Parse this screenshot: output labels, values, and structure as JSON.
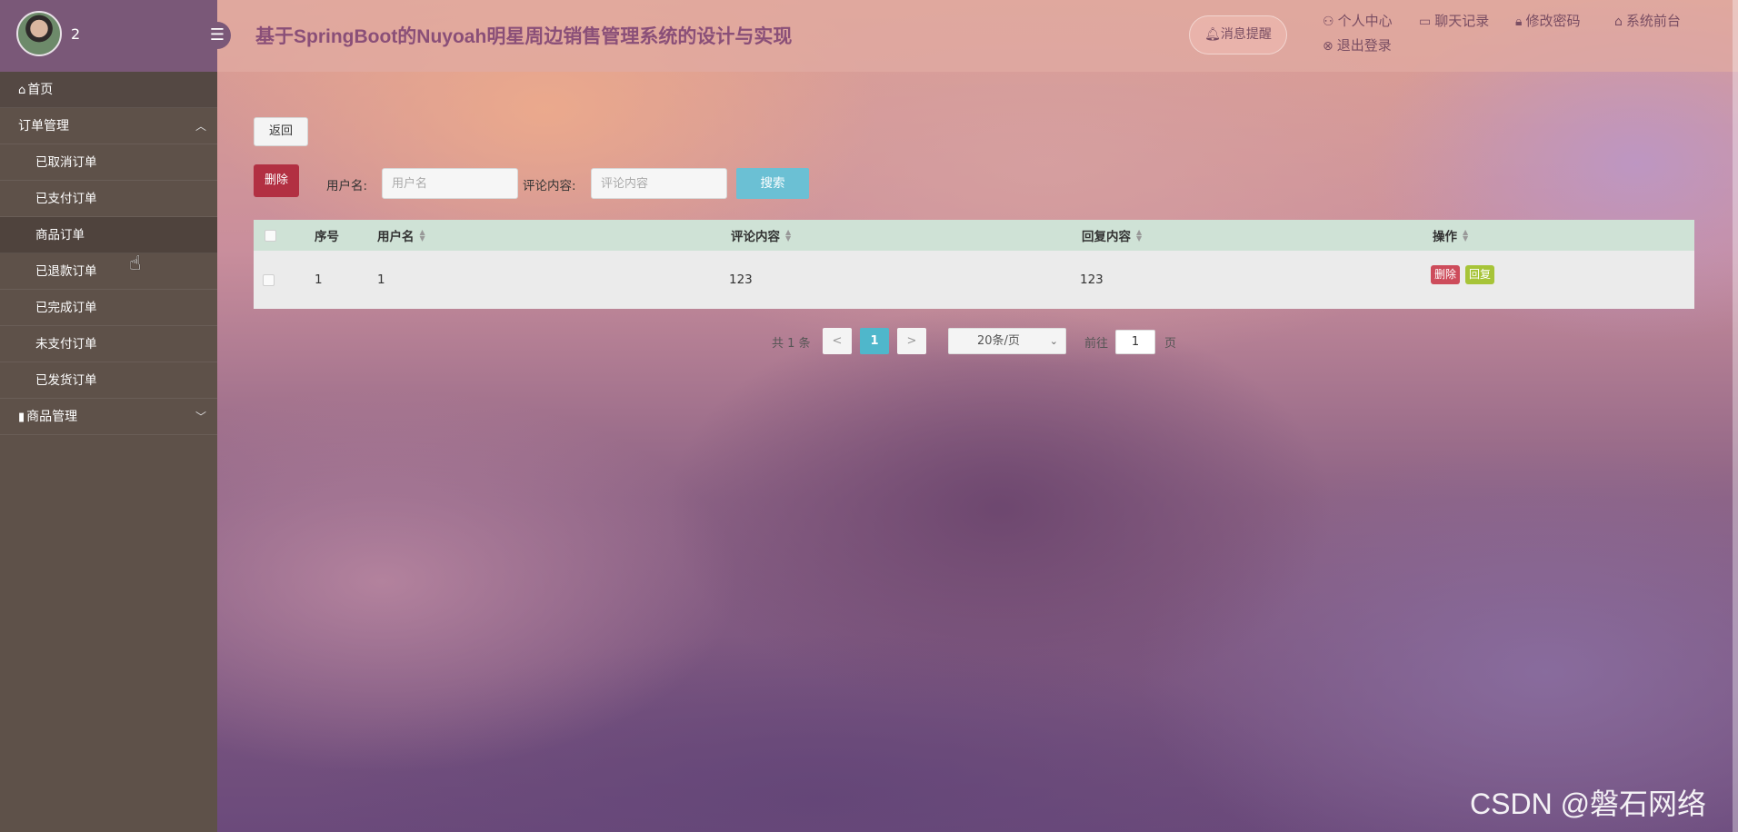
{
  "app": {
    "title": "基于SpringBoot的Nuyoah明星周边销售管理系统的设计与实现"
  },
  "user": {
    "name": "2"
  },
  "header": {
    "notify_label": "消息提醒",
    "links": {
      "profile": "个人中心",
      "chat": "聊天记录",
      "password": "修改密码",
      "frontend": "系统前台",
      "logout": "退出登录"
    }
  },
  "sidebar": {
    "home": "首页",
    "order_group": "订单管理",
    "order_items": [
      "已取消订单",
      "已支付订单",
      "商品订单",
      "已退款订单",
      "已完成订单",
      "未支付订单",
      "已发货订单"
    ],
    "goods_group": "商品管理"
  },
  "toolbar": {
    "back_label": "返回",
    "delete_label": "删除",
    "username_label": "用户名:",
    "username_placeholder": "用户名",
    "comment_label": "评论内容:",
    "comment_placeholder": "评论内容",
    "search_label": "搜索"
  },
  "table": {
    "columns": [
      "序号",
      "用户名",
      "评论内容",
      "回复内容",
      "操作"
    ],
    "rows": [
      {
        "index": "1",
        "username": "1",
        "comment": "123",
        "reply": "123",
        "actions": [
          "删除",
          "回复"
        ]
      }
    ]
  },
  "pagination": {
    "total": "共 1 条",
    "prev": "<",
    "current": "1",
    "next": ">",
    "page_size": "20条/页",
    "goto_prefix": "前往",
    "goto_value": "1",
    "goto_suffix": "页"
  },
  "watermark": "CSDN @磐石网络",
  "colors": {
    "sidebar_bg": "#5e5149",
    "sidebar_head": "#7a5878",
    "title": "#8a4f78",
    "delete_btn": "#b23042",
    "search_btn": "#6bc0d4",
    "table_header": "#cfe2d6",
    "reply_btn": "#a7c438"
  }
}
